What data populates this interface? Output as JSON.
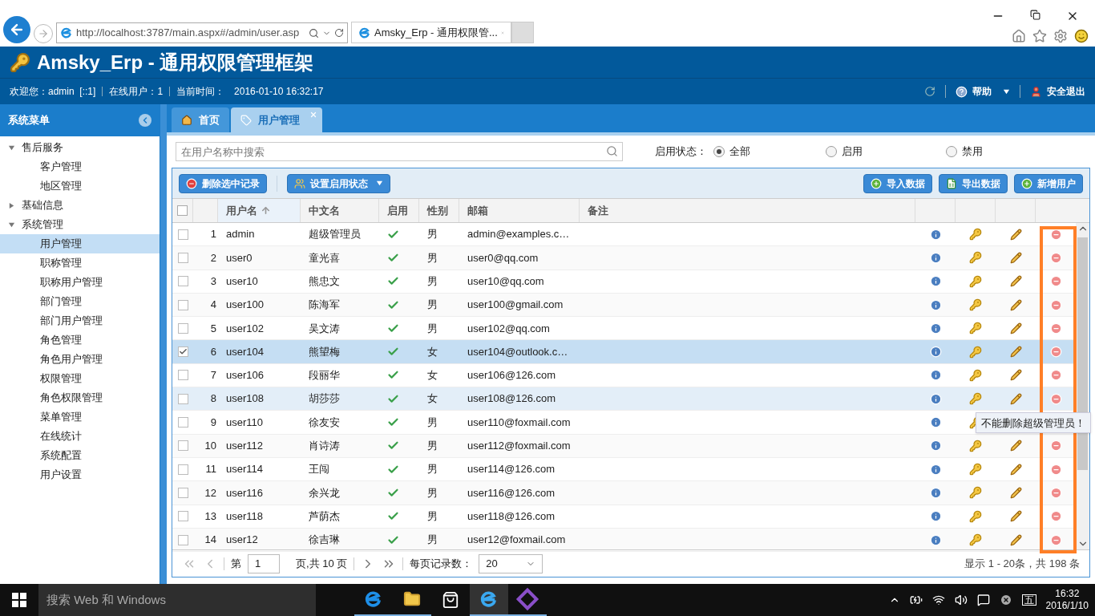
{
  "browser": {
    "address": "http://localhost:3787/main.aspx#/admin/user.asp",
    "tab_title": "Amsky_Erp - 通用权限管..."
  },
  "header": {
    "title": "Amsky_Erp - 通用权限管理框架",
    "welcome": "欢迎您：admin  [::1]",
    "online": "在线用户：1",
    "time_label": "当前时间：",
    "time": "2016-01-10 16:32:17",
    "help": "帮助",
    "logout": "安全退出"
  },
  "sidebar": {
    "title": "系统菜单",
    "tree": [
      {
        "label": "售后服务",
        "expanded": true,
        "selected": false,
        "children": [
          {
            "label": "客户管理",
            "selected": false
          },
          {
            "label": "地区管理",
            "selected": false
          }
        ]
      },
      {
        "label": "基础信息",
        "expanded": false,
        "selected": false
      },
      {
        "label": "系统管理",
        "expanded": true,
        "selected": false,
        "children": [
          {
            "label": "用户管理",
            "selected": true
          },
          {
            "label": "职称管理",
            "selected": false
          },
          {
            "label": "职称用户管理",
            "selected": false
          },
          {
            "label": "部门管理",
            "selected": false
          },
          {
            "label": "部门用户管理",
            "selected": false
          },
          {
            "label": "角色管理",
            "selected": false
          },
          {
            "label": "角色用户管理",
            "selected": false
          },
          {
            "label": "权限管理",
            "selected": false
          },
          {
            "label": "角色权限管理",
            "selected": false
          },
          {
            "label": "菜单管理",
            "selected": false
          },
          {
            "label": "在线统计",
            "selected": false
          },
          {
            "label": "系统配置",
            "selected": false
          },
          {
            "label": "用户设置",
            "selected": false
          }
        ]
      }
    ]
  },
  "tabs": [
    {
      "label": "首页",
      "kind": "home",
      "selected": false
    },
    {
      "label": "用户管理",
      "kind": "tag",
      "selected": true
    }
  ],
  "search": {
    "placeholder": "在用户名称中搜索"
  },
  "filter": {
    "label": "启用状态：",
    "options": [
      {
        "label": "全部",
        "selected": true
      },
      {
        "label": "启用",
        "selected": false
      },
      {
        "label": "禁用",
        "selected": false
      }
    ]
  },
  "toolbar_left": [
    {
      "label": "删除选中记录",
      "kind": "delete"
    },
    {
      "label": "设置启用状态",
      "kind": "dropdown"
    }
  ],
  "toolbar_right": [
    {
      "label": "导入数据",
      "kind": "add"
    },
    {
      "label": "导出数据",
      "kind": "excel"
    },
    {
      "label": "新增用户",
      "kind": "add"
    }
  ],
  "table": {
    "all_checked": false,
    "columns": [
      "用户名",
      "中文名",
      "启用",
      "性别",
      "邮箱",
      "备注"
    ],
    "rows": [
      {
        "no": "1",
        "username": "admin",
        "name": "超级管理员",
        "enabled": true,
        "gender": "男",
        "email": "admin@examples.c…",
        "checked": false,
        "selected": false,
        "hovered": false
      },
      {
        "no": "2",
        "username": "user0",
        "name": "童光喜",
        "enabled": true,
        "gender": "男",
        "email": "user0@qq.com",
        "checked": false,
        "selected": false,
        "hovered": false
      },
      {
        "no": "3",
        "username": "user10",
        "name": "熊忠文",
        "enabled": true,
        "gender": "男",
        "email": "user10@qq.com",
        "checked": false,
        "selected": false,
        "hovered": false
      },
      {
        "no": "4",
        "username": "user100",
        "name": "陈海军",
        "enabled": true,
        "gender": "男",
        "email": "user100@gmail.com",
        "checked": false,
        "selected": false,
        "hovered": false
      },
      {
        "no": "5",
        "username": "user102",
        "name": "吴文涛",
        "enabled": true,
        "gender": "男",
        "email": "user102@qq.com",
        "checked": false,
        "selected": false,
        "hovered": false
      },
      {
        "no": "6",
        "username": "user104",
        "name": "熊望梅",
        "enabled": true,
        "gender": "女",
        "email": "user104@outlook.c…",
        "checked": true,
        "selected": true,
        "hovered": false
      },
      {
        "no": "7",
        "username": "user106",
        "name": "段丽华",
        "enabled": true,
        "gender": "女",
        "email": "user106@126.com",
        "checked": false,
        "selected": false,
        "hovered": false
      },
      {
        "no": "8",
        "username": "user108",
        "name": "胡莎莎",
        "enabled": true,
        "gender": "女",
        "email": "user108@126.com",
        "checked": false,
        "selected": false,
        "hovered": true
      },
      {
        "no": "9",
        "username": "user110",
        "name": "徐友安",
        "enabled": true,
        "gender": "男",
        "email": "user110@foxmail.com",
        "checked": false,
        "selected": false,
        "hovered": false,
        "tooltip": "不能删除超级管理员！"
      },
      {
        "no": "10",
        "username": "user112",
        "name": "肖诗涛",
        "enabled": true,
        "gender": "男",
        "email": "user112@foxmail.com",
        "checked": false,
        "selected": false,
        "hovered": false
      },
      {
        "no": "11",
        "username": "user114",
        "name": "王闯",
        "enabled": true,
        "gender": "男",
        "email": "user114@126.com",
        "checked": false,
        "selected": false,
        "hovered": false
      },
      {
        "no": "12",
        "username": "user116",
        "name": "余兴龙",
        "enabled": true,
        "gender": "男",
        "email": "user116@126.com",
        "checked": false,
        "selected": false,
        "hovered": false
      },
      {
        "no": "13",
        "username": "user118",
        "name": "芦荫杰",
        "enabled": true,
        "gender": "男",
        "email": "user118@126.com",
        "checked": false,
        "selected": false,
        "hovered": false
      },
      {
        "no": "14",
        "username": "user12",
        "name": "徐吉琳",
        "enabled": true,
        "gender": "男",
        "email": "user12@foxmail.com",
        "checked": false,
        "selected": false,
        "hovered": false
      }
    ]
  },
  "pager": {
    "page_label": "第",
    "page": "1",
    "total": "页,共 10 页",
    "per_page_label": "每页记录数：",
    "per_page": "20",
    "summary": "显示 1 - 20条，共 198 条"
  },
  "taskbar": {
    "search_placeholder": "搜索 Web 和 Windows",
    "time": "16:32",
    "date": "2016/1/10",
    "ime": "五"
  }
}
